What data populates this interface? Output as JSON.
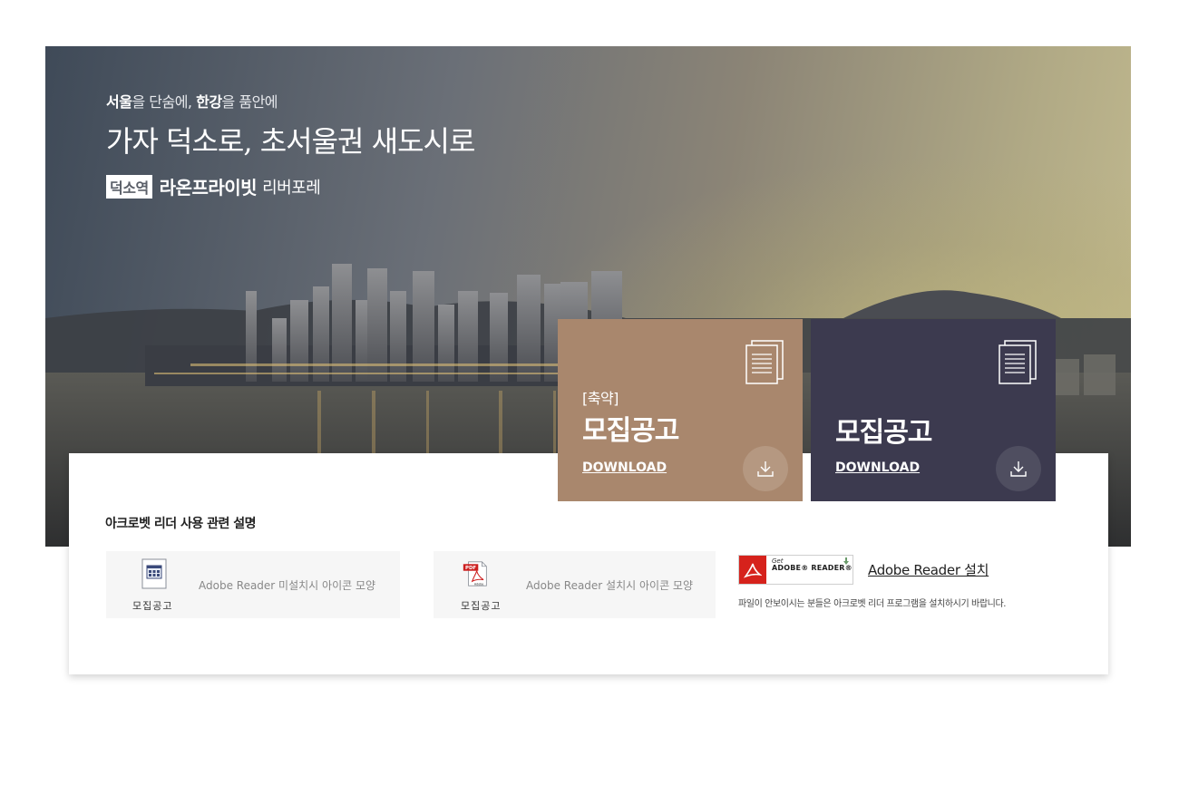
{
  "hero": {
    "tagline_part1": "서울",
    "tagline_part2": "을 단숨에, ",
    "tagline_part3": "한강",
    "tagline_part4": "을 품안에",
    "headline": "가자 덕소로, 초서울권 새도시로",
    "station_badge": "덕소역",
    "brand_name": "라온프라이빗",
    "brand_sub": "리버포레"
  },
  "cards": [
    {
      "prefix": "[축약]",
      "title": "모집공고",
      "download_label": "DOWNLOAD",
      "color": "#a9876d",
      "icon": "document-icon"
    },
    {
      "prefix": "",
      "title": "모집공고",
      "download_label": "DOWNLOAD",
      "color": "#3c3a4f",
      "icon": "document-icon"
    }
  ],
  "help": {
    "title": "아크로벳 리더 사용 관련 설명",
    "box1": {
      "icon": "generic-file-icon",
      "icon_label": "모집공고",
      "description": "Adobe Reader 미설치시 아이콘 모양"
    },
    "box2": {
      "icon": "pdf-file-icon",
      "icon_label": "모집공고",
      "description": "Adobe Reader 설치시 아이콘 모양"
    },
    "adobe_badge_get": "Get",
    "adobe_badge_reader": "ADOBE® READER®",
    "adobe_install_label": "Adobe Reader 설치",
    "adobe_note": "파일이 안보이시는 분들은 아크로벳 리더 프로그램을 설치하시기 바랍니다."
  }
}
